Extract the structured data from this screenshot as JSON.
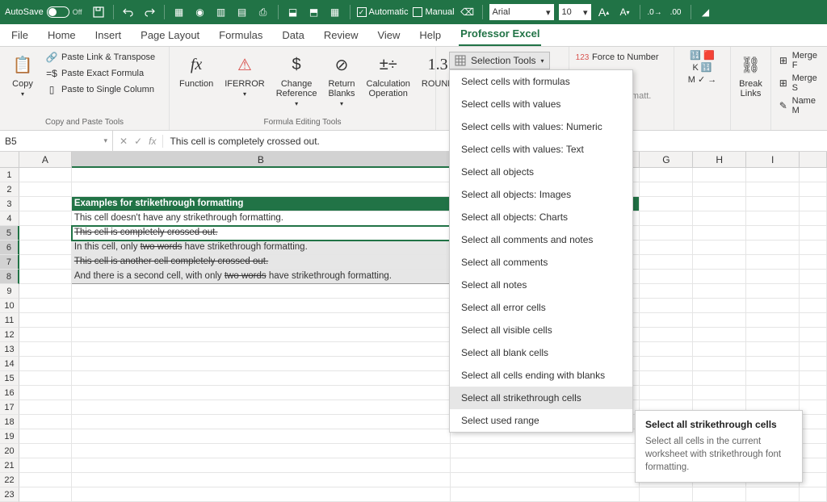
{
  "titlebar": {
    "autosave_label": "AutoSave",
    "autosave_state": "Off",
    "automatic_label": "Automatic",
    "manual_label": "Manual",
    "font_name": "Arial",
    "font_size": "10"
  },
  "tabs": {
    "file": "File",
    "home": "Home",
    "insert": "Insert",
    "page_layout": "Page Layout",
    "formulas": "Formulas",
    "data": "Data",
    "review": "Review",
    "view": "View",
    "help": "Help",
    "professor_excel": "Professor Excel"
  },
  "ribbon": {
    "copy_label": "Copy",
    "paste_link_transpose": "Paste Link & Transpose",
    "paste_exact_formula": "Paste Exact Formula",
    "paste_single_column": "Paste to Single Column",
    "copy_paste_group": "Copy and Paste Tools",
    "function_label": "Function",
    "iferror_label": "IFERROR",
    "change_reference_label": "Change\nReference",
    "return_blanks_label": "Return\nBlanks",
    "calculation_operation_label": "Calculation\nOperation",
    "round_label": "ROUND",
    "formula_editing_group": "Formula Editing Tools",
    "selection_tools_label": "Selection Tools",
    "force_number_label": "Force to Number",
    "cond_format_label": "Cond. Formatt.",
    "break_links_label": "Break\nLinks",
    "merge_label_1": "Merge F",
    "merge_label_2": "Merge S",
    "name_label": "Name M"
  },
  "formula_bar": {
    "name_box": "B5",
    "content": "This cell is completely crossed out."
  },
  "columns": [
    "A",
    "B",
    "G",
    "H",
    "I"
  ],
  "rows_range": [
    1,
    23
  ],
  "sheet": {
    "b3": "Examples for strikethrough formatting",
    "b4": "This cell doesn't have any strikethrough formatting.",
    "b5": "This cell is completely crossed out.",
    "b6_pre": "In this cell, only ",
    "b6_strike": "two words",
    "b6_post": " have strikethrough formatting.",
    "b7": "This cell is another cell completely crossed out.",
    "b8_pre": "And there is a second cell, with only ",
    "b8_strike": "two words",
    "b8_post": " have strikethrough formatting."
  },
  "dropdown": {
    "items": [
      "Select cells with formulas",
      "Select cells with values",
      "Select cells with values: Numeric",
      "Select cells with values: Text",
      "Select all objects",
      "Select all objects: Images",
      "Select all objects: Charts",
      "Select all comments and notes",
      "Select all comments",
      "Select all notes",
      "Select all error cells",
      "Select all visible cells",
      "Select all blank cells",
      "Select all cells ending with blanks",
      "Select all strikethrough cells",
      "Select used range"
    ],
    "hovered_index": 14
  },
  "tooltip": {
    "title": "Select all strikethrough cells",
    "body": "Select all cells in the current worksheet with strikethrough font formatting."
  }
}
